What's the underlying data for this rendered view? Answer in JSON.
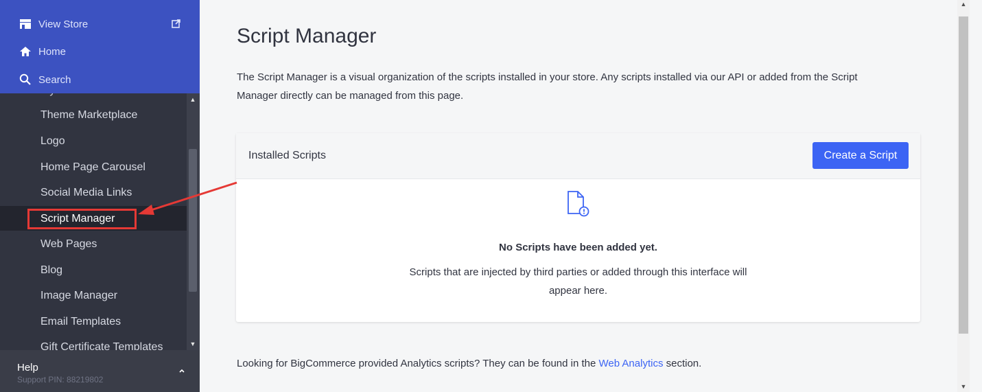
{
  "sidebar": {
    "top": {
      "view_store": "View Store",
      "home": "Home",
      "search": "Search"
    },
    "menu_items": [
      "My Themes",
      "Theme Marketplace",
      "Logo",
      "Home Page Carousel",
      "Social Media Links",
      "Script Manager",
      "Web Pages",
      "Blog",
      "Image Manager",
      "Email Templates",
      "Gift Certificate Templates"
    ],
    "active_item": "Script Manager",
    "help": {
      "title": "Help",
      "pin": "Support PIN: 88219802"
    }
  },
  "main": {
    "title": "Script Manager",
    "description": "The Script Manager is a visual organization of the scripts installed in your store. Any scripts installed via our API or added from the Script Manager directly can be managed from this page.",
    "card": {
      "title": "Installed Scripts",
      "create_button": "Create a Script",
      "empty_title": "No Scripts have been added yet.",
      "empty_text": "Scripts that are injected by third parties or added through this interface will appear here."
    },
    "footer": {
      "text_before": "Looking for BigCommerce provided Analytics scripts? They can be found in the ",
      "link": "Web Analytics",
      "text_after": " section."
    }
  },
  "colors": {
    "sidebar_top": "#3c52c1",
    "sidebar_bg": "#313440",
    "accent": "#3c64f4",
    "annotation": "#e53935"
  }
}
